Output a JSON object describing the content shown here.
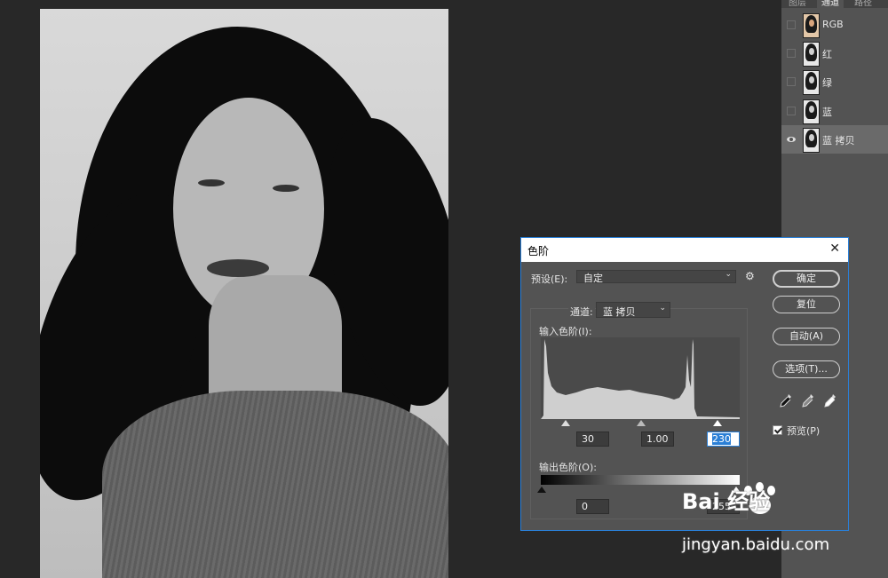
{
  "panel": {
    "tabs": [
      "图层",
      "通道",
      "路径"
    ],
    "channels": [
      {
        "name": "RGB",
        "visible": false,
        "selected": false
      },
      {
        "name": "红",
        "visible": false,
        "selected": false
      },
      {
        "name": "绿",
        "visible": false,
        "selected": false
      },
      {
        "name": "蓝",
        "visible": false,
        "selected": false
      },
      {
        "name": "蓝 拷贝",
        "visible": true,
        "selected": true
      }
    ]
  },
  "dialog": {
    "title": "色阶",
    "close": "✕",
    "preset_label": "预设(E):",
    "preset_value": "自定",
    "channel_label": "通道:",
    "channel_value": "蓝 拷贝",
    "input_levels_label": "输入色阶(I):",
    "input_black": "30",
    "input_gamma": "1.00",
    "input_white": "230",
    "output_levels_label": "输出色阶(O):",
    "output_black": "0",
    "output_white": "255",
    "buttons": {
      "ok": "确定",
      "reset": "复位",
      "auto": "自动(A)",
      "options": "选项(T)..."
    },
    "preview_label": "预览(P)",
    "preview_checked": true,
    "gear_icon": "⚙",
    "dropdown_arrow": "⌄"
  },
  "watermark": {
    "main": "Bai 经验",
    "sub": "jingyan.baidu.com"
  }
}
